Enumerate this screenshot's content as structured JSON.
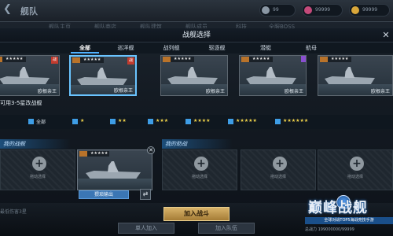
{
  "topbar": {
    "back_icon": "back-arrow-icon",
    "title": "舰队",
    "resources": [
      {
        "value": "99",
        "color": "#8a97a4"
      },
      {
        "value": "99999",
        "color": "#c44a7a"
      },
      {
        "value": "99999",
        "color": "#d9a73a"
      }
    ],
    "bg_tabs": [
      "舰队主页",
      "舰队商店",
      "舰队建筑",
      "舰队成员",
      "科技",
      "全服BOSS"
    ]
  },
  "modal": {
    "title": "战舰选择",
    "close_icon": "close-icon",
    "tabs": [
      "全部",
      "巡洋舰",
      "战列舰",
      "驱逐舰",
      "潜艇",
      "航母"
    ],
    "active_tab": 0
  },
  "ships": [
    {
      "name": "欧根亲王",
      "stars": "★★★★★",
      "badge": "战",
      "selected": false
    },
    {
      "name": "欧根亲王",
      "stars": "★★★★★",
      "badge": "战",
      "selected": true
    },
    {
      "name": "欧根亲王",
      "stars": "★★★★★",
      "badge": "",
      "selected": false
    },
    {
      "name": "欧根亲王",
      "stars": "★★★★★",
      "badge": "",
      "selected": false
    },
    {
      "name": "欧根亲王",
      "stars": "★★★★★",
      "badge": "",
      "selected": false
    },
    {
      "name": "欧根亲王",
      "stars": "★★★★★",
      "badge": "",
      "selected": false
    }
  ],
  "hint": "可用3-5星改战舰",
  "filters": [
    {
      "label": "全部",
      "checked": true
    },
    {
      "label": "★",
      "checked": true
    },
    {
      "label": "★★",
      "checked": true
    },
    {
      "label": "★★★",
      "checked": true
    },
    {
      "label": "★★★★",
      "checked": true
    },
    {
      "label": "★★★★★",
      "checked": true
    },
    {
      "label": "★★★★★★",
      "checked": true
    }
  ],
  "my_ships": {
    "header": "我的战舰",
    "filled": {
      "stars": "★★★★★",
      "role_button": "猥琐输出",
      "swap_icon": "swap-icon",
      "close_icon": "close-icon"
    },
    "empty_label": "拖动选择",
    "plus_icon": "plus-icon"
  },
  "my_help": {
    "header": "我的助战",
    "empty_label": "拖动选择"
  },
  "bottom": {
    "join_button": "加入战斗",
    "left_text": "最低伤害3星",
    "bg_button_1": "单人加入",
    "bg_button_2": "加入队伍"
  },
  "logo": {
    "main": "巅峰战舰",
    "emblem_icon": "anchor-emblem-icon",
    "sub": "全球对战TOP5海战竞技手游",
    "power": "总战力 199000000/99999"
  }
}
